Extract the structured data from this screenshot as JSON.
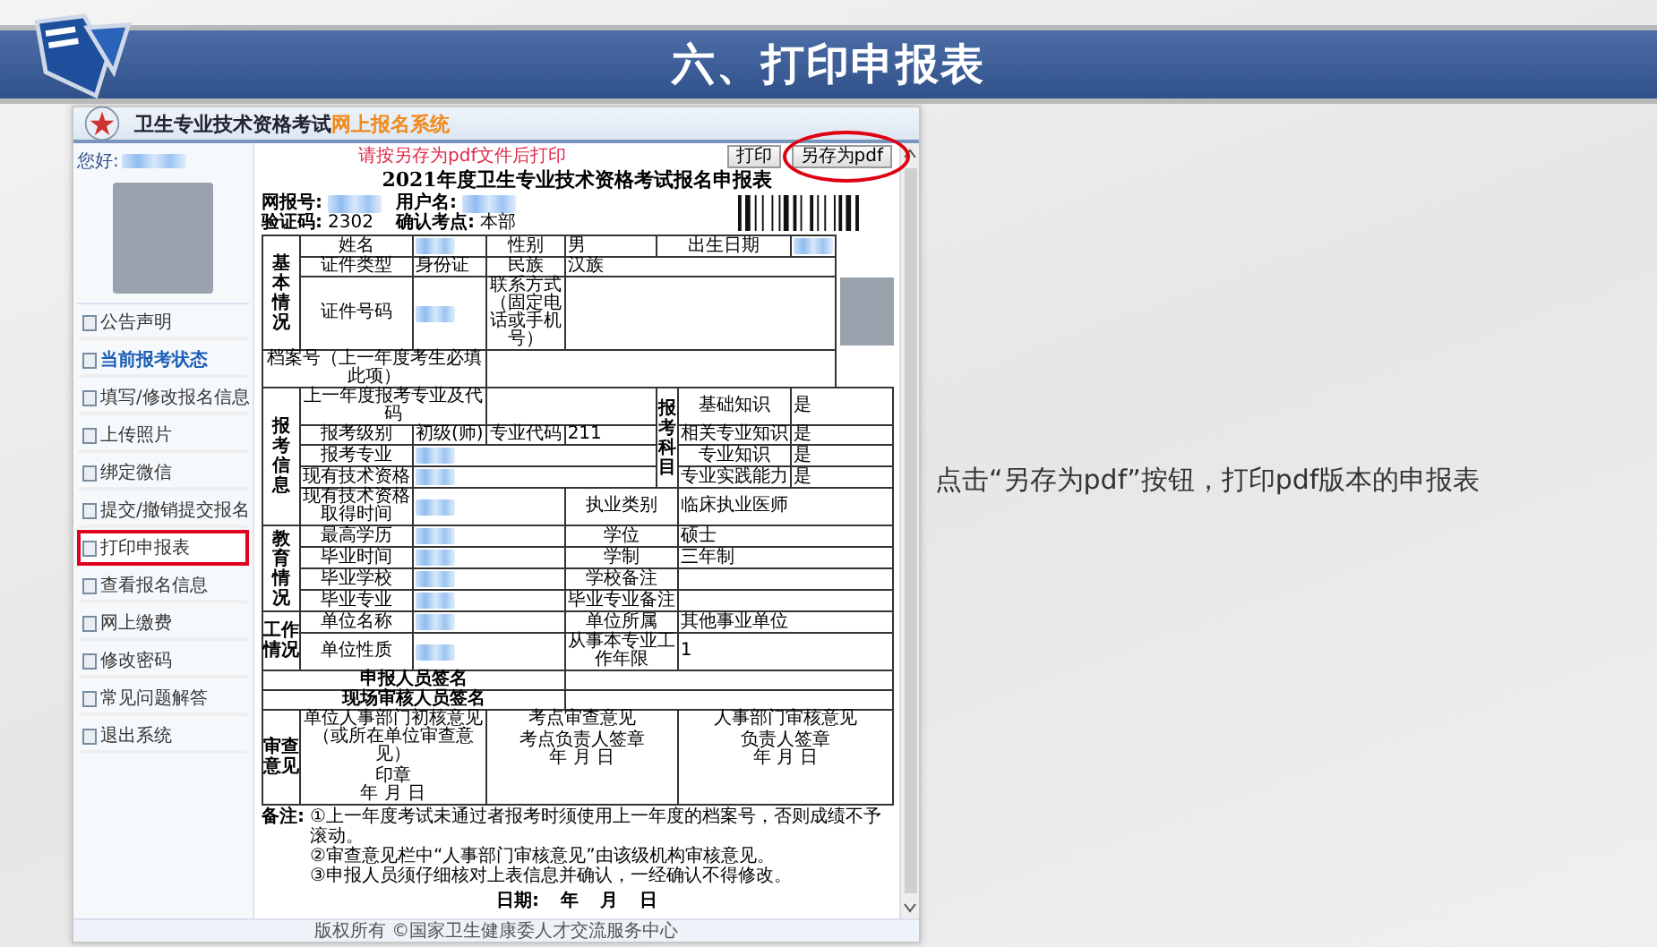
{
  "slide_title": "六、打印申报表",
  "caption": "点击“另存为pdf”按钮，打印pdf版本的申报表",
  "app": {
    "system_title": "卫生专业技术资格考试",
    "system_subtitle": "网上报名系统",
    "greeting": "您好:",
    "menu": [
      {
        "label": "公告声明",
        "selected": false,
        "active": false
      },
      {
        "label": "当前报考状态",
        "selected": false,
        "active": true
      },
      {
        "label": "填写/修改报名信息",
        "selected": false,
        "active": false
      },
      {
        "label": "上传照片",
        "selected": false,
        "active": false
      },
      {
        "label": "绑定微信",
        "selected": false,
        "active": false
      },
      {
        "label": "提交/撤销提交报名",
        "selected": false,
        "active": false
      },
      {
        "label": "打印申报表",
        "selected": true,
        "active": false
      },
      {
        "label": "查看报名信息",
        "selected": false,
        "active": false
      },
      {
        "label": "网上缴费",
        "selected": false,
        "active": false
      },
      {
        "label": "修改密码",
        "selected": false,
        "active": false
      },
      {
        "label": "常见问题解答",
        "selected": false,
        "active": false
      },
      {
        "label": "退出系统",
        "selected": false,
        "active": false
      }
    ],
    "hint": "请按另存为pdf文件后打印",
    "buttons": [
      {
        "label": "打印",
        "highlighted": false
      },
      {
        "label": "另存为pdf",
        "highlighted": true
      }
    ],
    "form": {
      "title": "2021年度卫生专业技术资格考试报名申报表",
      "meta": [
        {
          "label": "网报号:",
          "kind": "blur"
        },
        {
          "label": "用户名:",
          "kind": "blur"
        },
        {
          "label": "验证码:",
          "kind": "text",
          "value": "2302"
        },
        {
          "label": "确认考点:",
          "kind": "text",
          "value": "本部"
        }
      ],
      "rows": [
        [
          {
            "kind": "section",
            "text": "基本情况",
            "rowspan": 3
          },
          {
            "kind": "label",
            "text": "姓名"
          },
          {
            "kind": "blur"
          },
          {
            "kind": "label",
            "text": "性别"
          },
          {
            "kind": "value",
            "text": "男"
          },
          {
            "kind": "label",
            "text": "出生日期",
            "colspan": 2
          },
          {
            "kind": "blur"
          },
          {
            "kind": "photo",
            "rowspan": 4
          }
        ],
        [
          {
            "kind": "label",
            "text": "证件类型"
          },
          {
            "kind": "value",
            "text": "身份证"
          },
          {
            "kind": "label",
            "text": "民族"
          },
          {
            "kind": "value",
            "text": "汉族",
            "colspan": 4
          }
        ],
        [
          {
            "kind": "label",
            "text": "证件号码"
          },
          {
            "kind": "blur"
          },
          {
            "kind": "label",
            "text": "联系方式（固定电话或手机号）"
          },
          {
            "kind": "empty",
            "colspan": 4
          }
        ],
        [
          {
            "kind": "label",
            "text": "档案号（上一年度考生必填此项）",
            "colspan": 3
          },
          {
            "kind": "empty",
            "colspan": 5
          }
        ],
        [
          {
            "kind": "section",
            "text": "报考信息",
            "rowspan": 5
          },
          {
            "kind": "label",
            "text": "上一年度报考专业及代码",
            "colspan": 2
          },
          {
            "kind": "empty",
            "colspan": 2
          },
          {
            "kind": "section",
            "text": "报考科目",
            "rowspan": 4
          },
          {
            "kind": "label",
            "text": "基础知识"
          },
          {
            "kind": "value",
            "text": "是",
            "colspan": 2
          }
        ],
        [
          {
            "kind": "label",
            "text": "报考级别"
          },
          {
            "kind": "value",
            "text": "初级(师)"
          },
          {
            "kind": "label",
            "text": "专业代码"
          },
          {
            "kind": "value",
            "text": "211"
          },
          {
            "kind": "label",
            "text": "相关专业知识"
          },
          {
            "kind": "value",
            "text": "是",
            "colspan": 2
          }
        ],
        [
          {
            "kind": "label",
            "text": "报考专业"
          },
          {
            "kind": "blur",
            "colspan": 3
          },
          {
            "kind": "label",
            "text": "专业知识"
          },
          {
            "kind": "value",
            "text": "是",
            "colspan": 2
          }
        ],
        [
          {
            "kind": "label",
            "text": "现有技术资格"
          },
          {
            "kind": "blur",
            "colspan": 3
          },
          {
            "kind": "label",
            "text": "专业实践能力"
          },
          {
            "kind": "value",
            "text": "是",
            "colspan": 2
          }
        ],
        [
          {
            "kind": "label",
            "text": "现有技术资格取得时间"
          },
          {
            "kind": "blur",
            "colspan": 2
          },
          {
            "kind": "label",
            "text": "执业类别",
            "colspan": 2
          },
          {
            "kind": "value",
            "text": "临床执业医师",
            "colspan": 3
          }
        ],
        [
          {
            "kind": "section",
            "text": "教育情况",
            "rowspan": 4
          },
          {
            "kind": "label",
            "text": "最高学历"
          },
          {
            "kind": "blur",
            "colspan": 2
          },
          {
            "kind": "label",
            "text": "学位",
            "colspan": 2
          },
          {
            "kind": "value",
            "text": "硕士",
            "colspan": 3
          }
        ],
        [
          {
            "kind": "label",
            "text": "毕业时间"
          },
          {
            "kind": "blur",
            "colspan": 2
          },
          {
            "kind": "label",
            "text": "学制",
            "colspan": 2
          },
          {
            "kind": "value",
            "text": "三年制",
            "colspan": 3
          }
        ],
        [
          {
            "kind": "label",
            "text": "毕业学校"
          },
          {
            "kind": "blur",
            "colspan": 2
          },
          {
            "kind": "label",
            "text": "学校备注",
            "colspan": 2
          },
          {
            "kind": "empty",
            "colspan": 3
          }
        ],
        [
          {
            "kind": "label",
            "text": "毕业专业"
          },
          {
            "kind": "blur",
            "colspan": 2
          },
          {
            "kind": "label",
            "text": "毕业专业备注",
            "colspan": 2
          },
          {
            "kind": "empty",
            "colspan": 3
          }
        ],
        [
          {
            "kind": "section",
            "text": "工作情况",
            "rowspan": 2
          },
          {
            "kind": "label",
            "text": "单位名称"
          },
          {
            "kind": "blur",
            "colspan": 2
          },
          {
            "kind": "label",
            "text": "单位所属",
            "colspan": 2
          },
          {
            "kind": "value",
            "text": "其他事业单位",
            "colspan": 3
          }
        ],
        [
          {
            "kind": "label",
            "text": "单位性质"
          },
          {
            "kind": "blur",
            "colspan": 2
          },
          {
            "kind": "label",
            "text": "从事本专业工作年限",
            "colspan": 2
          },
          {
            "kind": "value",
            "text": "1",
            "colspan": 3
          }
        ],
        [
          {
            "kind": "label",
            "text": "申报人员签名",
            "colspan": 4,
            "bold": true
          },
          {
            "kind": "empty",
            "colspan": 5
          }
        ],
        [
          {
            "kind": "label",
            "text": "现场审核人员签名",
            "colspan": 4,
            "bold": true
          },
          {
            "kind": "empty",
            "colspan": 5
          }
        ],
        [
          {
            "kind": "section",
            "text": "审查意见"
          },
          {
            "kind": "review",
            "text": "单位人事部门初核意见（或所在单位审查意见）",
            "sign": "印章",
            "date": "年 月 日",
            "colspan": 2
          },
          {
            "kind": "review",
            "text": "考点审查意见",
            "sign": "考点负责人签章",
            "date": "年 月 日",
            "colspan": 3
          },
          {
            "kind": "review",
            "text": "人事部门审核意见",
            "sign": "负责人签章",
            "date": "年 月 日",
            "colspan": 3
          }
        ]
      ],
      "notes_label": "备注:",
      "notes": [
        "①上一年度考试未通过者报考时须使用上一年度的档案号，否则成绩不予滚动。",
        "②审查意见栏中“人事部门审核意见”由该级机构审核意见。",
        "③申报人员须仔细核对上表信息并确认，一经确认不得修改。"
      ],
      "date_label": "日期:",
      "date_parts": [
        "年",
        "月",
        "日"
      ]
    },
    "footer": "版权所有 ©国家卫生健康委人才交流服务中心"
  }
}
